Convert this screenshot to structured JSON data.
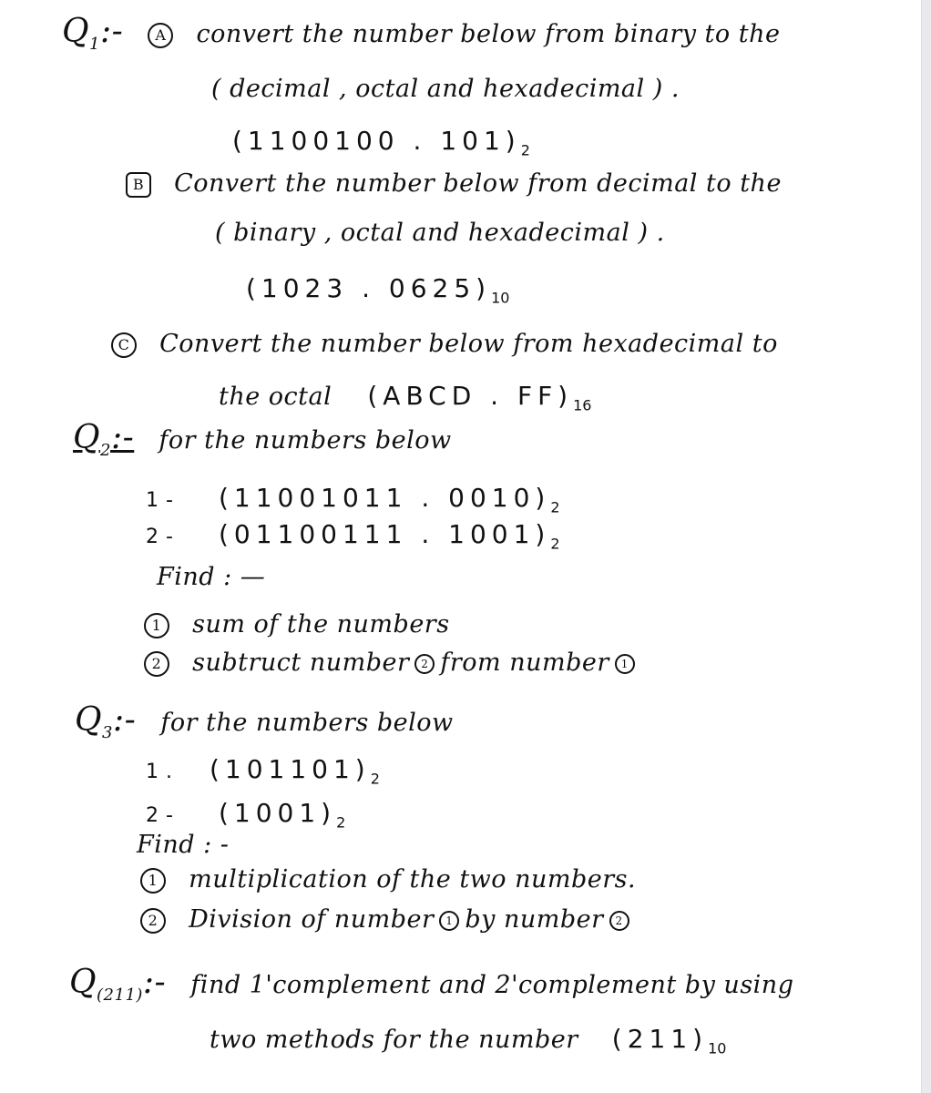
{
  "document": {
    "questions": [
      {
        "label": "Q",
        "number": "1",
        "suffix": ":-",
        "parts": [
          {
            "marker": "A",
            "line1": "convert the number below from binary to the",
            "line2": "( decimal , octal and hexadecimal ) .",
            "number": "(1100100 . 101)",
            "base": "2"
          },
          {
            "marker": "B",
            "line1": "Convert the number below from decimal to the",
            "line2": "( binary , octal and hexadecimal ) .",
            "number": "(1023 . 0625)",
            "base": "10"
          },
          {
            "marker": "C",
            "line1": "Convert the number below from hexadecimal to",
            "line2": "the octal",
            "number": "(ABCD . FF)",
            "base": "16"
          }
        ]
      },
      {
        "label": "Q",
        "number": "2",
        "suffix": ":-",
        "intro": "for the numbers below",
        "numbers": [
          {
            "index": "1 -",
            "value": "(11001011 . 0010)",
            "base": "2"
          },
          {
            "index": "2 -",
            "value": "(01100111 . 1001)",
            "base": "2"
          }
        ],
        "find_label": "Find : —",
        "tasks": [
          {
            "marker": "1",
            "text": "sum of the numbers"
          },
          {
            "marker": "2",
            "text_before": "subtruct number",
            "ref1": "2",
            "text_mid": "from number",
            "ref2": "1"
          }
        ]
      },
      {
        "label": "Q",
        "number": "3",
        "suffix": ":-",
        "intro": "for the numbers below",
        "numbers": [
          {
            "index": "1 .",
            "value": "(101101)",
            "base": "2"
          },
          {
            "index": "2 -",
            "value": "(1001)",
            "base": "2"
          }
        ],
        "find_label": "Find : -",
        "tasks": [
          {
            "marker": "1",
            "text": "multiplication of the two numbers."
          },
          {
            "marker": "2",
            "text_before": "Division of number",
            "ref1": "1",
            "text_mid": "by number",
            "ref2": "2"
          }
        ]
      },
      {
        "label": "Q",
        "number": "(211)",
        "suffix": ":-",
        "line1": "find 1'complement and 2'complement by using",
        "line2": "two methods for the number",
        "base": "10"
      }
    ]
  }
}
